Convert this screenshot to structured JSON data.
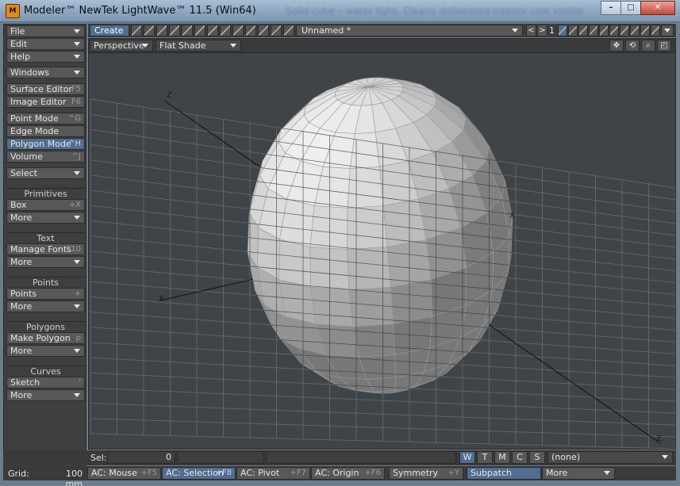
{
  "window": {
    "title": "Modeler™ NewTek LightWave™ 11.5 (Win64)",
    "background_text": "Solid cube – water light. Clearly delineated interior (not visible",
    "icon_label": "M",
    "minimize": "–",
    "maximize": "□",
    "close": "✕"
  },
  "sidebar": {
    "file": "File",
    "edit": "Edit",
    "help": "Help",
    "windows": "Windows",
    "surface_editor": {
      "label": "Surface Editor",
      "shortcut": "F5"
    },
    "image_editor": {
      "label": "Image Editor",
      "shortcut": "F6"
    },
    "point_mode": {
      "label": "Point Mode",
      "shortcut": "^G"
    },
    "edge_mode": {
      "label": "Edge Mode",
      "shortcut": ""
    },
    "polygon_mode": {
      "label": "Polygon Mode",
      "shortcut": "^H"
    },
    "volume": {
      "label": "Volume",
      "shortcut": "^J"
    },
    "select": "Select",
    "primitives": {
      "heading": "Primitives",
      "item": "Box",
      "shortcut": "+X",
      "more": "More"
    },
    "text": {
      "heading": "Text",
      "item": "Manage Fonts",
      "shortcut": "F10",
      "more": "More"
    },
    "points": {
      "heading": "Points",
      "item": "Points",
      "shortcut": "+",
      "more": "More"
    },
    "polygons": {
      "heading": "Polygons",
      "item": "Make Polygon",
      "shortcut": "p",
      "more": "More"
    },
    "curves": {
      "heading": "Curves",
      "item": "Sketch",
      "shortcut": "'",
      "more": "More"
    }
  },
  "toolbar": {
    "create_tab": "Create",
    "document": "Unnamed *",
    "prev": "<",
    "next": ">",
    "layer_number": "1"
  },
  "viewport": {
    "view_type": "Perspective",
    "shading": "Flat Shade",
    "icons": [
      "move-view-icon",
      "rotate-view-icon",
      "zoom-view-icon",
      "maximize-view-icon"
    ],
    "axis_labels": {
      "z_top": "Z",
      "x_right": "X",
      "x_left": "X",
      "z_bottom": "Z"
    }
  },
  "status": {
    "sel_label": "Sel:",
    "sel_value": "0",
    "layer_buttons": [
      "W",
      "T",
      "M",
      "C",
      "S"
    ],
    "active_layer_button": "W",
    "surface": "(none)"
  },
  "bottom": {
    "grid_label": "Grid:",
    "grid_value": "100 mm",
    "ac_mouse": {
      "label": "AC: Mouse",
      "shortcut": "+F5"
    },
    "ac_selection": {
      "label": "AC: Selection",
      "shortcut": "+F8"
    },
    "ac_pivot": {
      "label": "AC: Pivot",
      "shortcut": "+F7"
    },
    "ac_origin": {
      "label": "AC: Origin",
      "shortcut": "+F6"
    },
    "symmetry": {
      "label": "Symmetry",
      "shortcut": "+Y"
    },
    "subpatch": "Subpatch",
    "more": "More"
  },
  "colors": {
    "accent": "#526d8f",
    "panel": "#3f3f3f",
    "viewport_bg": "#3f4448",
    "grid_line": "#5f656a",
    "sphere_base": "#c9c9c9"
  }
}
